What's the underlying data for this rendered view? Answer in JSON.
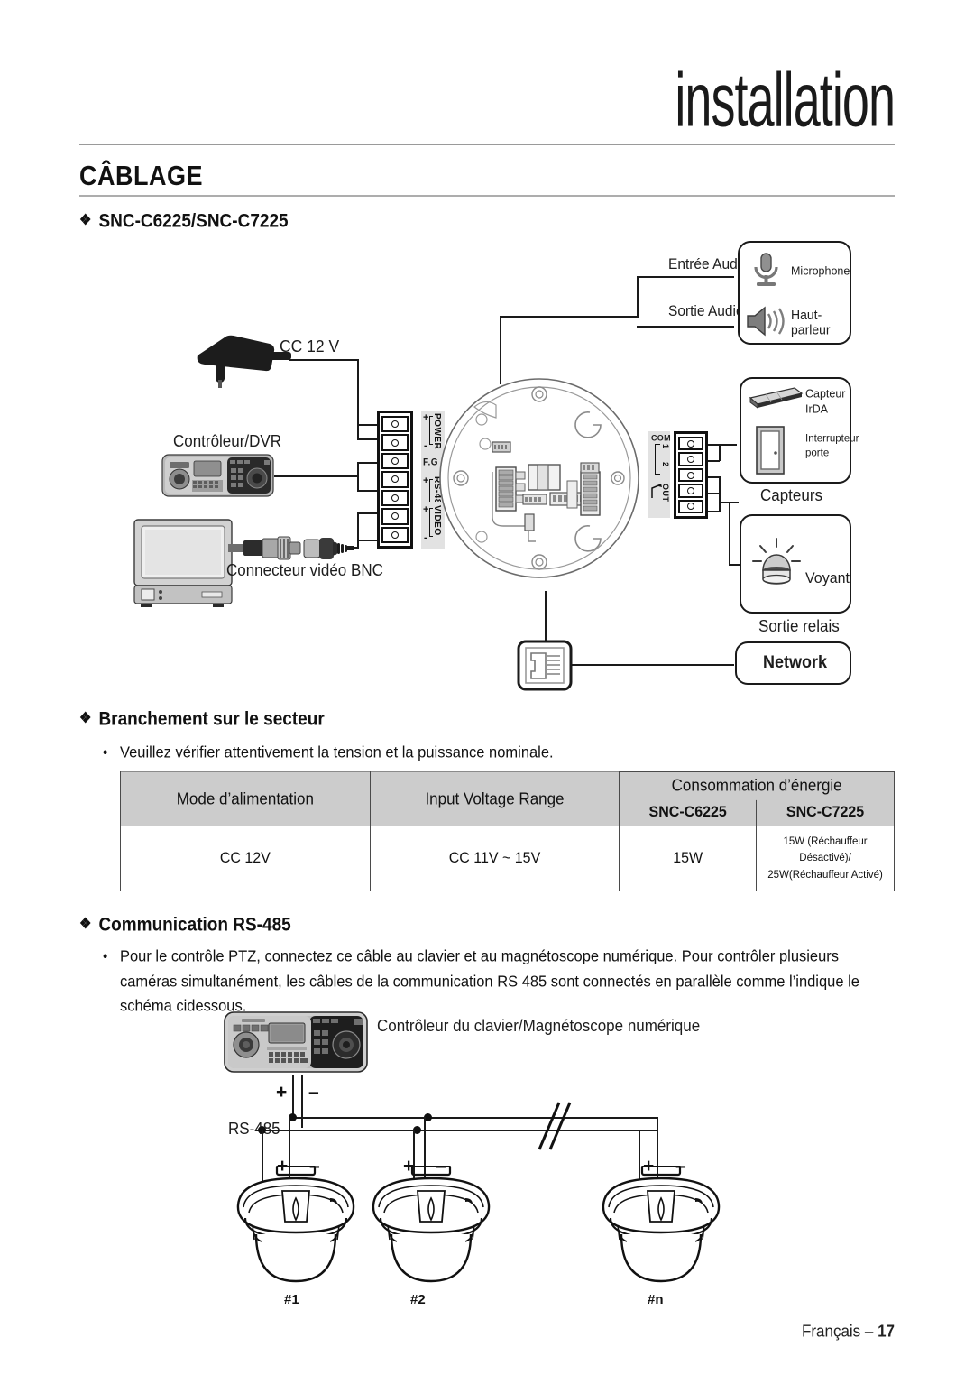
{
  "header": {
    "chapter": "installation",
    "section_title": "CÂBLAGE"
  },
  "sections": {
    "models": {
      "title": "SNC-C6225/SNC-C7225"
    },
    "power": {
      "title": "Branchement sur le secteur",
      "bullet": "Veuillez vérifier attentivement la tension et la puissance nominale."
    },
    "rs485": {
      "title": "Communication RS-485",
      "bullet": "Pour le contrôle PTZ, connectez ce câble au clavier et au magnétoscope numérique. Pour contrôler plusieurs caméras simultanément, les câbles de la communication RS 485 sont connectés en parallèle comme l’indique le schéma cidessous."
    }
  },
  "wiring_diagram": {
    "power_supply_label": "CC 12 V",
    "controller_label": "Contrôleur/DVR",
    "bnc_label": "Connecteur vidéo BNC",
    "terminal_labels": {
      "power": "POWER",
      "fg": "F.G",
      "rs485": "RS-485",
      "video": "VIDEO",
      "plus": "+",
      "minus": "-"
    },
    "audio_in_label": "Entrée Audio",
    "audio_out_label": "Sortie Audio",
    "microphone_label": "Microphone",
    "speaker_label": "Haut-\nparleur",
    "speaker_line1": "Haut-",
    "speaker_line2": "parleur",
    "irda_label_line1": "Capteur",
    "irda_label_line2": "IrDA",
    "door_switch_line1": "Interrupteur",
    "door_switch_line2": "porte",
    "sensors_caption": "Capteurs",
    "alarm_label": "Voyant",
    "relay_caption": "Sortie relais",
    "network_label": "Network",
    "alarm_terminal": {
      "com": "COM",
      "p1": "1",
      "p2": "2",
      "out": "OUT"
    }
  },
  "power_table": {
    "headers": {
      "mode": "Mode d’alimentation",
      "voltage": "Input Voltage Range",
      "consumption": "Consommation d’énergie",
      "model_a": "SNC-C6225",
      "model_b": "SNC-C7225"
    },
    "rows": [
      {
        "mode": "CC 12V",
        "voltage": "CC 11V ~ 15V",
        "c6225": "15W",
        "c7225_line1": "15W (Réchauffeur Désactivé)/",
        "c7225_line2": "25W(Réchauffeur Activé)"
      }
    ]
  },
  "rs485_diagram": {
    "controller_label": "Contrôleur du clavier/Magnétoscope numérique",
    "bus_label": "RS-485",
    "plus": "+",
    "minus": "–",
    "cameras": [
      {
        "label": "#1"
      },
      {
        "label": "#2"
      },
      {
        "label": "#n"
      }
    ]
  },
  "footer": {
    "language": "Français – ",
    "page": "17"
  },
  "colors": {
    "ink": "#111111",
    "header_rule": "#9a9a9a",
    "table_header_bg": "#cccccc",
    "label_bg": "#e2e2e2"
  }
}
